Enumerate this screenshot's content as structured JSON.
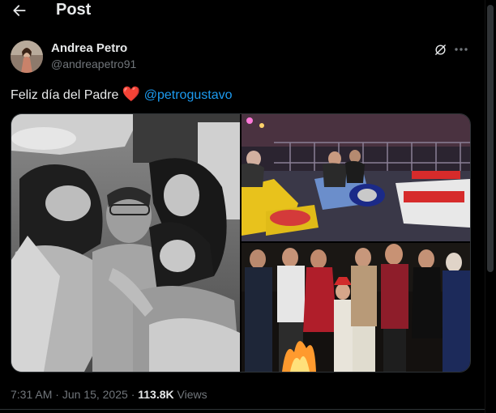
{
  "header": {
    "title": "Post",
    "back_icon": "arrow-left-icon"
  },
  "author": {
    "name": "Andrea Petro",
    "handle": "@andreapetro91",
    "avatar_icon": "profile-avatar"
  },
  "actions": {
    "grok_icon": "grok-icon",
    "more_icon": "more-horizontal-icon"
  },
  "tweet": {
    "text": "Feliz día del Padre",
    "emoji": "❤️",
    "mention": "@petrogustavo"
  },
  "media": {
    "photos": [
      {
        "name": "family-photo-bw",
        "description_icon": "photo"
      },
      {
        "name": "bumper-cars-photo",
        "description_icon": "photo"
      },
      {
        "name": "group-bonfire-photo",
        "description_icon": "photo"
      }
    ]
  },
  "meta": {
    "time": "7:31 AM",
    "separator": "·",
    "date": "Jun 15, 2025",
    "views_count": "113.8K",
    "views_label": "Views"
  },
  "colors": {
    "background": "#000000",
    "text": "#e7e9ea",
    "secondary": "#71767b",
    "accent": "#1d9bf0",
    "heart": "#f4212e",
    "border": "#2f3336"
  }
}
